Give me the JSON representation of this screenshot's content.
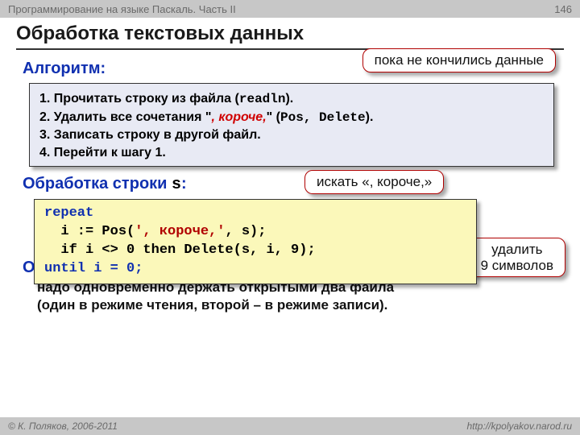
{
  "header": {
    "course": "Программирование на языке Паскаль. Часть II",
    "page": "146"
  },
  "title": "Обработка текстовых данных",
  "algo": {
    "heading": "Алгоритм:",
    "s1a": "1. Прочитать строку из файла (",
    "s1b": "readln",
    "s1c": ").",
    "s2a": "2. Удалить все сочетания \"",
    "s2b": ", короче,",
    "s2c": "\" (",
    "s2d": "Pos, Delete",
    "s2e": ").",
    "s3": "3. Записать строку в другой файл.",
    "s4": "4. Перейти к шагу 1."
  },
  "callouts": {
    "while_data": "пока не кончились данные",
    "search": "искать «, короче,»",
    "delete9a": "удалить",
    "delete9b": "9 символов"
  },
  "str_section_a": "Обработка строки ",
  "str_section_b": "s",
  "str_section_c": ":",
  "code": {
    "l1": "repeat",
    "l2a": "  i := Pos(",
    "l2b": "', короче,'",
    "l2c": ", s);",
    "l3": "  if i <> 0 then Delete(s, i, 9);",
    "l4": "until i = 0;"
  },
  "feature": {
    "heading": "Особенность:",
    "body1": "надо одновременно держать открытыми два файла",
    "body2": "(один в режиме чтения, второй – в режиме записи)."
  },
  "footer": {
    "left": "© К. Поляков, 2006-2011",
    "right": "http://kpolyakov.narod.ru"
  }
}
